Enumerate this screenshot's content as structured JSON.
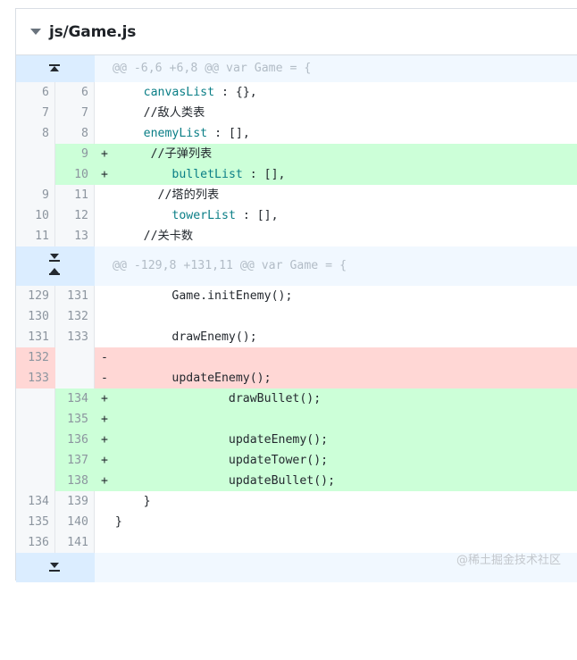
{
  "file": {
    "name": "js/Game.js"
  },
  "hunks": [
    {
      "header": "@@ -6,6 +6,8 @@ var Game = {"
    },
    {
      "header": "@@ -129,8 +131,11 @@ var Game = {"
    }
  ],
  "block1": [
    {
      "type": "ctx",
      "old": "6",
      "new": "6",
      "sign": " ",
      "pre": "     ",
      "kw": "canvasList",
      "post": " : {},"
    },
    {
      "type": "ctx",
      "old": "7",
      "new": "7",
      "sign": " ",
      "pre": "     //敌人类表",
      "kw": "",
      "post": ""
    },
    {
      "type": "ctx",
      "old": "8",
      "new": "8",
      "sign": " ",
      "pre": "     ",
      "kw": "enemyList",
      "post": " : [],"
    },
    {
      "type": "add",
      "old": "",
      "new": "9",
      "sign": "+",
      "pre": "      //子弹列表",
      "kw": "",
      "post": ""
    },
    {
      "type": "add",
      "old": "",
      "new": "10",
      "sign": "+",
      "pre": "         ",
      "kw": "bulletList",
      "post": " : [],"
    },
    {
      "type": "ctx",
      "old": "9",
      "new": "11",
      "sign": " ",
      "pre": "       //塔的列表",
      "kw": "",
      "post": ""
    },
    {
      "type": "ctx",
      "old": "10",
      "new": "12",
      "sign": " ",
      "pre": "         ",
      "kw": "towerList",
      "post": " : [],"
    },
    {
      "type": "ctx",
      "old": "11",
      "new": "13",
      "sign": " ",
      "pre": "     //关卡数",
      "kw": "",
      "post": ""
    }
  ],
  "block2": [
    {
      "type": "ctx",
      "old": "129",
      "new": "131",
      "sign": " ",
      "text": "         Game.initEnemy();"
    },
    {
      "type": "ctx",
      "old": "130",
      "new": "132",
      "sign": " ",
      "text": ""
    },
    {
      "type": "ctx",
      "old": "131",
      "new": "133",
      "sign": " ",
      "text": "         drawEnemy();"
    },
    {
      "type": "del",
      "old": "132",
      "new": "",
      "sign": "-",
      "text": ""
    },
    {
      "type": "del",
      "old": "133",
      "new": "",
      "sign": "-",
      "text": "         updateEnemy();"
    },
    {
      "type": "add",
      "old": "",
      "new": "134",
      "sign": "+",
      "text": "                 drawBullet();"
    },
    {
      "type": "add",
      "old": "",
      "new": "135",
      "sign": "+",
      "text": ""
    },
    {
      "type": "add",
      "old": "",
      "new": "136",
      "sign": "+",
      "text": "                 updateEnemy();"
    },
    {
      "type": "add",
      "old": "",
      "new": "137",
      "sign": "+",
      "text": "                 updateTower();"
    },
    {
      "type": "add",
      "old": "",
      "new": "138",
      "sign": "+",
      "text": "                 updateBullet();"
    },
    {
      "type": "ctx",
      "old": "134",
      "new": "139",
      "sign": " ",
      "text": "     }"
    },
    {
      "type": "ctx",
      "old": "135",
      "new": "140",
      "sign": " ",
      "text": " }"
    },
    {
      "type": "ctx",
      "old": "136",
      "new": "141",
      "sign": " ",
      "text": ""
    }
  ],
  "watermark": "@稀土掘金技术社区"
}
